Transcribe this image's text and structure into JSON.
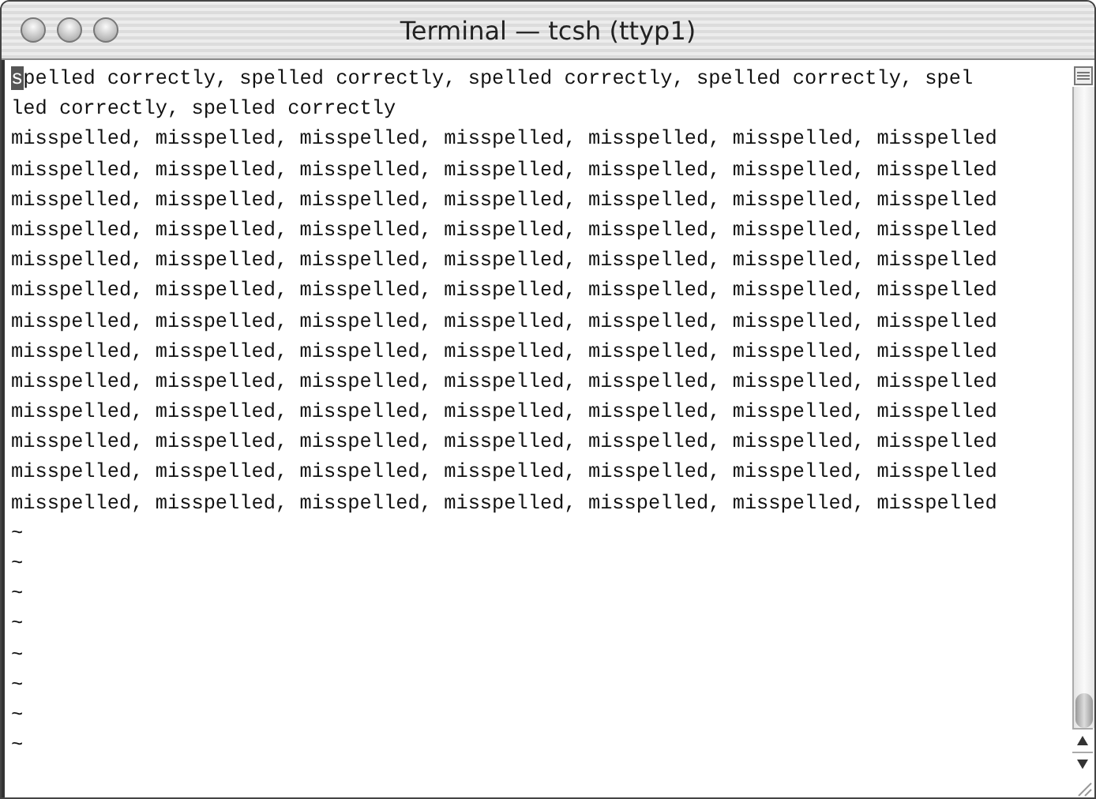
{
  "window": {
    "title": "Terminal — tcsh (ttyp1)"
  },
  "lines": [
    {
      "text": "spelled correctly, spelled correctly, spelled correctly, spelled correctly, spel",
      "cursor": true
    },
    {
      "text": "led correctly, spelled correctly",
      "cursor": false
    },
    {
      "text": "misspelled, misspelled, misspelled, misspelled, misspelled, misspelled, misspelled",
      "cursor": false
    },
    {
      "text": "misspelled, misspelled, misspelled, misspelled, misspelled, misspelled, misspelled",
      "cursor": false
    },
    {
      "text": "misspelled, misspelled, misspelled, misspelled, misspelled, misspelled, misspelled",
      "cursor": false
    },
    {
      "text": "misspelled, misspelled, misspelled, misspelled, misspelled, misspelled, misspelled",
      "cursor": false
    },
    {
      "text": "misspelled, misspelled, misspelled, misspelled, misspelled, misspelled, misspelled",
      "cursor": false
    },
    {
      "text": "misspelled, misspelled, misspelled, misspelled, misspelled, misspelled, misspelled",
      "cursor": false
    },
    {
      "text": "misspelled, misspelled, misspelled, misspelled, misspelled, misspelled, misspelled",
      "cursor": false
    },
    {
      "text": "misspelled, misspelled, misspelled, misspelled, misspelled, misspelled, misspelled",
      "cursor": false
    },
    {
      "text": "misspelled, misspelled, misspelled, misspelled, misspelled, misspelled, misspelled",
      "cursor": false
    },
    {
      "text": "misspelled, misspelled, misspelled, misspelled, misspelled, misspelled, misspelled",
      "cursor": false
    },
    {
      "text": "misspelled, misspelled, misspelled, misspelled, misspelled, misspelled, misspelled",
      "cursor": false
    },
    {
      "text": "misspelled, misspelled, misspelled, misspelled, misspelled, misspelled, misspelled",
      "cursor": false
    },
    {
      "text": "misspelled, misspelled, misspelled, misspelled, misspelled, misspelled, misspelled",
      "cursor": false
    },
    {
      "text": "~",
      "cursor": false
    },
    {
      "text": "~",
      "cursor": false
    },
    {
      "text": "~",
      "cursor": false
    },
    {
      "text": "~",
      "cursor": false
    },
    {
      "text": "~",
      "cursor": false
    },
    {
      "text": "~",
      "cursor": false
    },
    {
      "text": "~",
      "cursor": false
    },
    {
      "text": "~",
      "cursor": false
    }
  ]
}
